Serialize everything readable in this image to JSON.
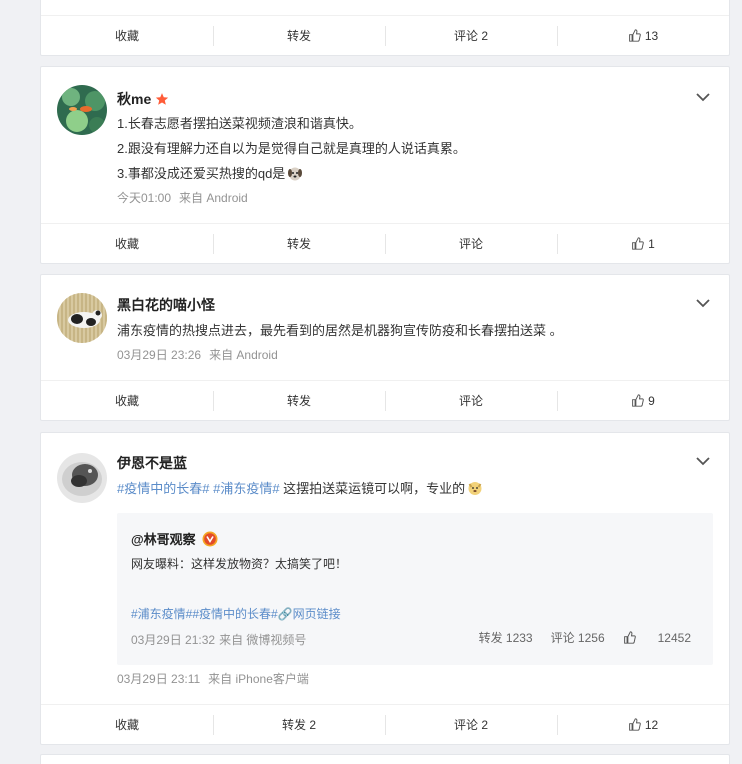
{
  "card0": {
    "actions": {
      "fav": "收藏",
      "forward": "转发",
      "comment": "评论 2",
      "like": "13"
    }
  },
  "card1": {
    "name": "秋me",
    "lines": [
      "1.长春志愿者摆拍送菜视频渣浪和谐真快。",
      "2.跟没有理解力还自以为是觉得自己就是真理的人说话真累。",
      "3.事都没成还爱买热搜的qd是"
    ],
    "time": "今天01:00",
    "source": "来自 Android",
    "actions": {
      "fav": "收藏",
      "forward": "转发",
      "comment": "评论",
      "like": "1"
    }
  },
  "card2": {
    "name": "黑白花的喵小怪",
    "text": "浦东疫情的热搜点进去，最先看到的居然是机器狗宣传防疫和长春摆拍送菜 。",
    "time": "03月29日 23:26",
    "source": "来自 Android",
    "actions": {
      "fav": "收藏",
      "forward": "转发",
      "comment": "评论",
      "like": "9"
    }
  },
  "card3": {
    "name": "伊恩不是蓝",
    "tag1": "#疫情中的长春#",
    "tag2": "#浦东疫情#",
    "text": " 这摆拍送菜运镜可以啊，专业的",
    "quote": {
      "name": "@林哥观察",
      "text": "网友曝料：这样发放物资？太搞笑了吧！",
      "tags": "#浦东疫情##疫情中的长春#🔗网页链接",
      "time": "03月29日 21:32",
      "source": "来自 微博视频号",
      "forward": "转发 1233",
      "comment": "评论 1256",
      "like": "12452"
    },
    "time": "03月29日 23:11",
    "source": "来自 iPhone客户端",
    "actions": {
      "fav": "收藏",
      "forward": "转发 2",
      "comment": "评论 2",
      "like": "12"
    }
  },
  "colors": {
    "link": "#5b8cc9",
    "meta": "#939393",
    "star": "#ff5c38",
    "vip": "#f5a623"
  },
  "icons": [
    "like-icon",
    "chevron-down-icon",
    "star-icon",
    "verified-v-icon",
    "sad-dog-emoji",
    "doge-emoji"
  ]
}
